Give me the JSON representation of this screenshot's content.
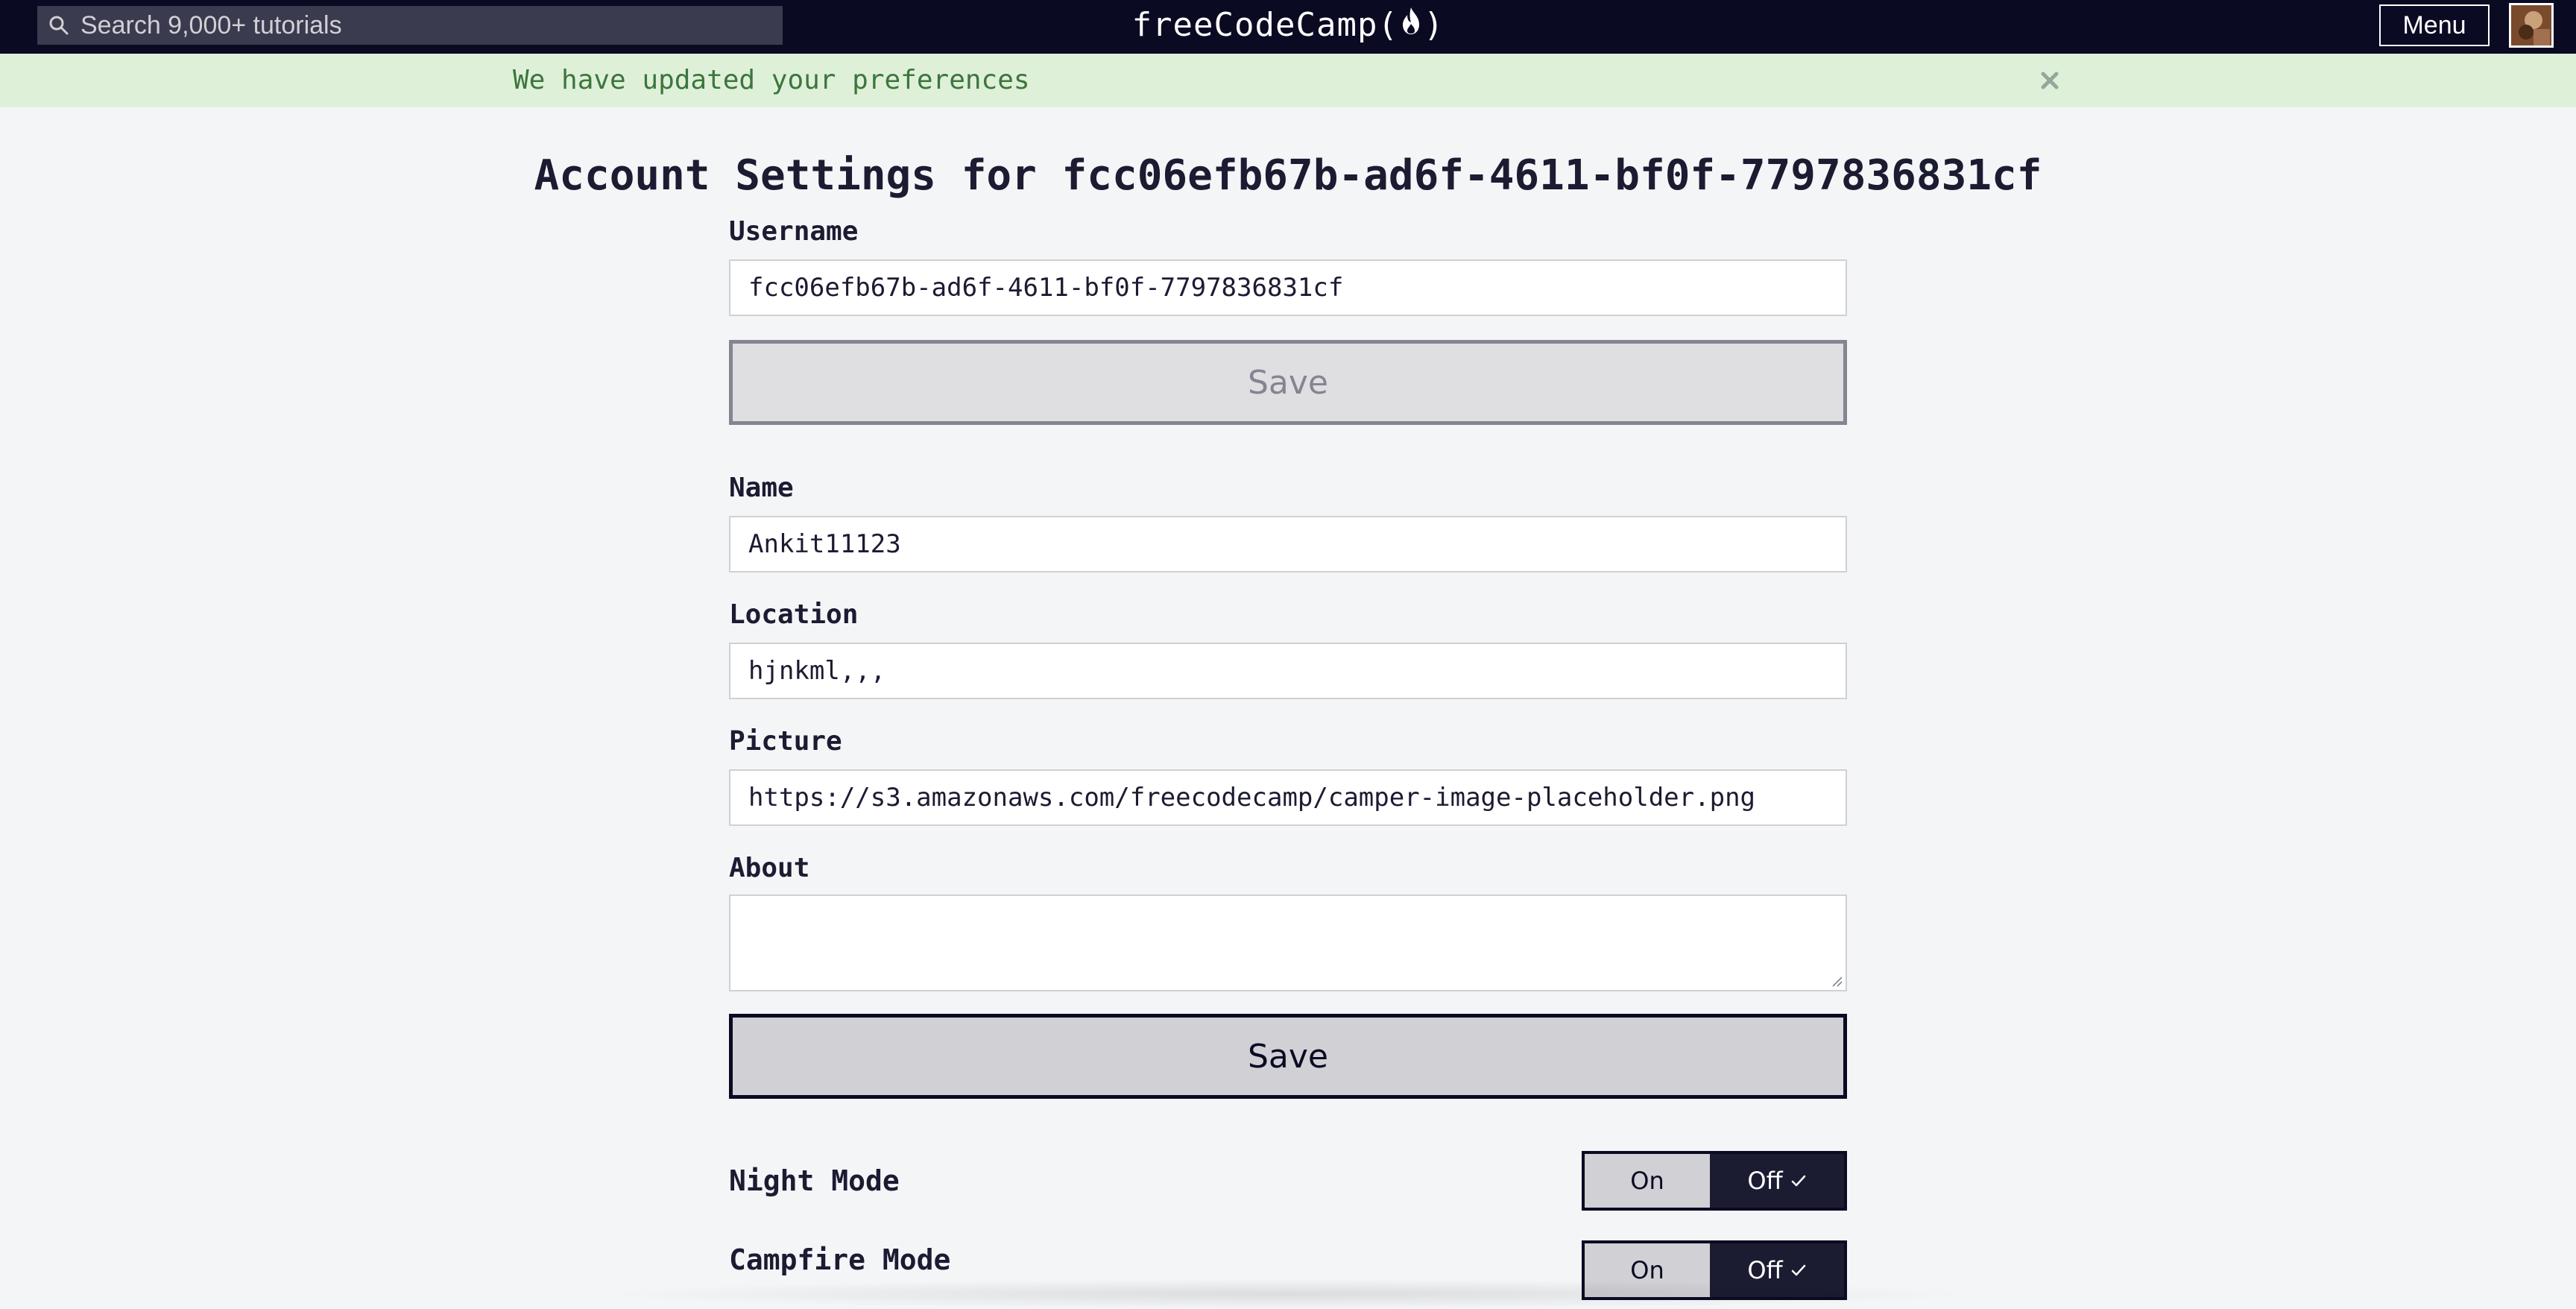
{
  "nav": {
    "search_placeholder": "Search 9,000+ tutorials",
    "logo_text_left": "freeCodeCamp(",
    "logo_text_right": ")",
    "menu_label": "Menu"
  },
  "flash": {
    "message": "We have updated your preferences"
  },
  "page": {
    "title": "Account Settings for fcc06efb67b-ad6f-4611-bf0f-7797836831cf"
  },
  "username_form": {
    "label": "Username",
    "value": "fcc06efb67b-ad6f-4611-bf0f-7797836831cf",
    "save_label": "Save"
  },
  "about_form": {
    "name_label": "Name",
    "name_value": "Ankit11123",
    "location_label": "Location",
    "location_value": "hjnkml,,,",
    "picture_label": "Picture",
    "picture_value": "https://s3.amazonaws.com/freecodecamp/camper-image-placeholder.png",
    "about_label": "About",
    "about_value": "",
    "save_label": "Save"
  },
  "toggles": {
    "night_mode": {
      "label": "Night Mode",
      "on_label": "On",
      "off_label": "Off",
      "selected": "Off"
    },
    "campfire_mode": {
      "label": "Campfire Mode",
      "on_label": "On",
      "off_label": "Off",
      "selected": "Off"
    }
  },
  "colors": {
    "nav_bg": "#0a0a23",
    "flash_bg": "#dff0d8",
    "flash_text": "#3c763d",
    "page_bg": "#f4f5f7"
  }
}
